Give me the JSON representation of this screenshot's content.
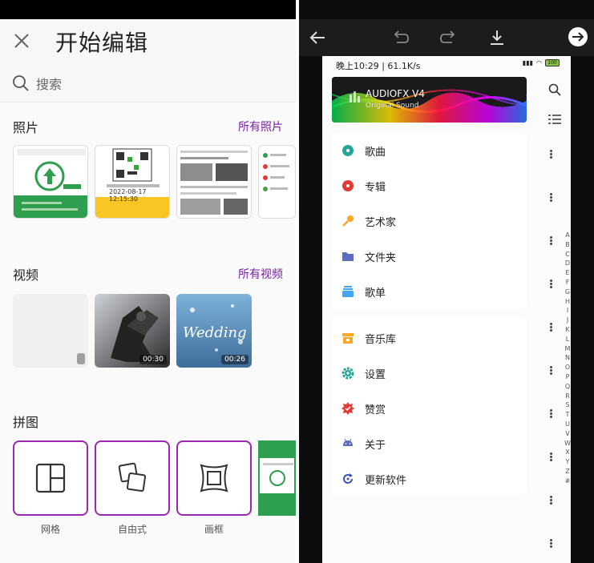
{
  "left": {
    "title": "开始编辑",
    "search_label": "搜索",
    "photos": {
      "title": "照片",
      "more": "所有照片"
    },
    "videos": {
      "title": "视频",
      "more": "所有视频",
      "durations": [
        "00:30",
        "00:26"
      ]
    },
    "collage": {
      "title": "拼图",
      "items": [
        {
          "label": "网格",
          "icon": "grid-layout-icon"
        },
        {
          "label": "自由式",
          "icon": "freestyle-layout-icon"
        },
        {
          "label": "画框",
          "icon": "frame-layout-icon"
        }
      ]
    },
    "photo_texts": {
      "p1_date": "2022-08-17 12:15:30",
      "p2_date": "2022-08-17 12:15:30"
    }
  },
  "right": {
    "status": {
      "time": "晚上10:29 | 61.1K/s",
      "battery": "100"
    },
    "banner": {
      "title": "AUDIOFX V4",
      "subtitle": "Original Sound"
    },
    "menu_group1": [
      {
        "label": "歌曲",
        "icon": "disc-icon",
        "color": "#26a69a"
      },
      {
        "label": "专辑",
        "icon": "album-icon",
        "color": "#e53935"
      },
      {
        "label": "艺术家",
        "icon": "microphone-icon",
        "color": "#f9a825"
      },
      {
        "label": "文件夹",
        "icon": "folder-icon",
        "color": "#5c6bc0"
      },
      {
        "label": "歌单",
        "icon": "playlist-icon",
        "color": "#42a5f5"
      }
    ],
    "menu_group2": [
      {
        "label": "音乐库",
        "icon": "library-icon",
        "color": "#ffa726"
      },
      {
        "label": "设置",
        "icon": "gear-icon",
        "color": "#26a69a"
      },
      {
        "label": "赞赏",
        "icon": "badge-icon",
        "color": "#e53935"
      },
      {
        "label": "关于",
        "icon": "android-icon",
        "color": "#5c6bc0"
      },
      {
        "label": "更新软件",
        "icon": "update-icon",
        "color": "#3f51b5"
      }
    ],
    "alphabet": [
      "A",
      "B",
      "C",
      "D",
      "E",
      "F",
      "G",
      "H",
      "I",
      "J",
      "K",
      "L",
      "M",
      "N",
      "O",
      "P",
      "Q",
      "R",
      "S",
      "T",
      "U",
      "V",
      "W",
      "X",
      "Y",
      "Z",
      "#"
    ]
  }
}
